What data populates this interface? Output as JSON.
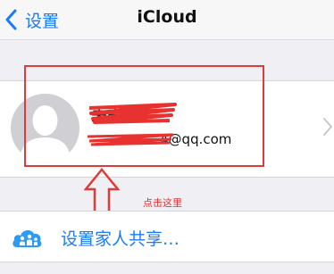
{
  "navbar": {
    "back_label": "设置",
    "title": "iCloud"
  },
  "account": {
    "name": "未安卓",
    "email_visible": "4@qq.com",
    "icon": "default-avatar-icon"
  },
  "annotation": {
    "hint": "点击这里",
    "color": "#e03a3a"
  },
  "family": {
    "label": "设置家人共享…",
    "icon": "family-sharing-icon"
  },
  "colors": {
    "link_blue": "#1a7bfa",
    "background": "#efeff4"
  }
}
